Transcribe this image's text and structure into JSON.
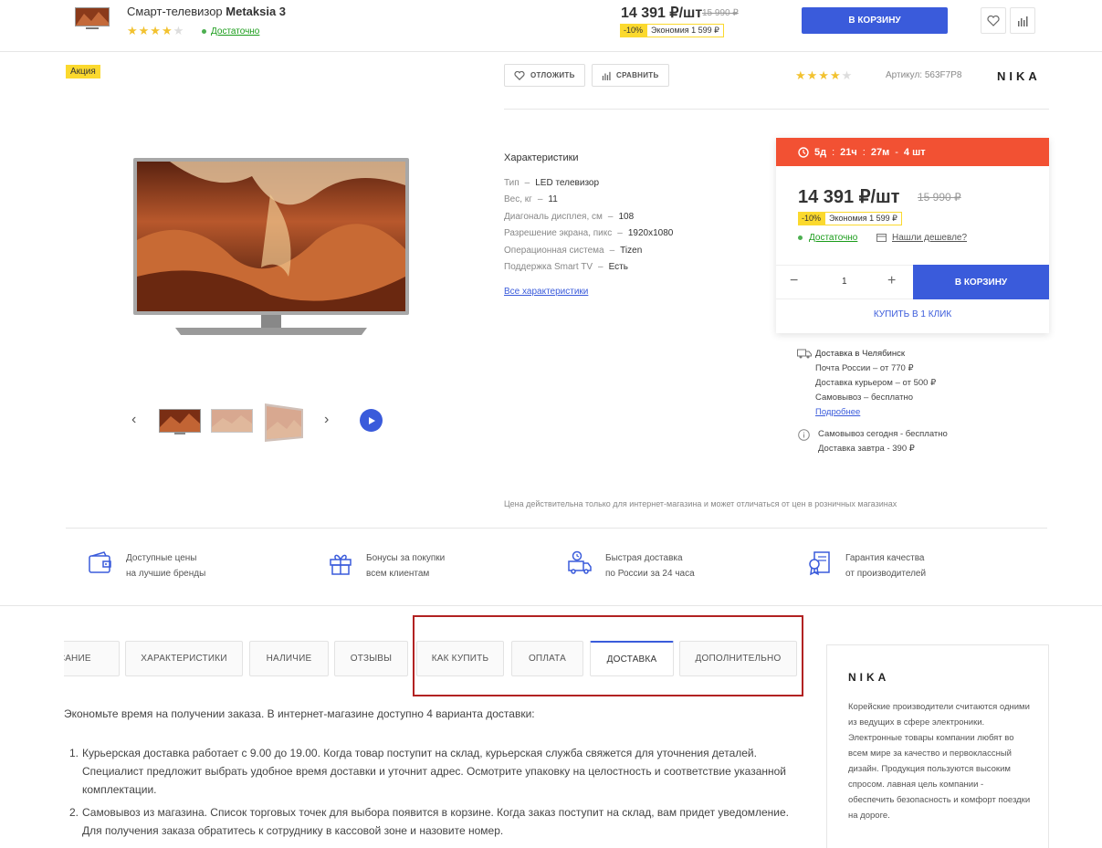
{
  "topbar": {
    "product_name_prefix": "Смарт-телевизор ",
    "product_name_model": "Metaksia 3",
    "rating_stars": 4,
    "stock": "Достаточно",
    "price": "14 391 ₽/шт",
    "old_price": "15 990 ₽",
    "discount_pct": "-10%",
    "discount_save": "Экономия 1 599 ₽",
    "cart_button": "В КОРЗИНУ"
  },
  "gallery": {
    "promo_badge": "Акция"
  },
  "actions": {
    "defer_label": "ОТЛОЖИТЬ",
    "compare_label": "СРАВНИТЬ",
    "rating_stars": 4,
    "article": "Артикул: 563F7P8",
    "brand": "NIKA"
  },
  "specs": {
    "title": "Характеристики",
    "rows": [
      {
        "k": "Тип",
        "v": "LED телевизор"
      },
      {
        "k": "Вес, кг",
        "v": "11"
      },
      {
        "k": "Диагональ дисплея, см",
        "v": "108"
      },
      {
        "k": "Разрешение экрана, пикс",
        "v": "1920x1080"
      },
      {
        "k": "Операционная система",
        "v": "Tizen"
      },
      {
        "k": "Поддержка Smart TV",
        "v": "Есть"
      }
    ],
    "all_link": "Все характеристики"
  },
  "buybox": {
    "timer_days": "5д",
    "timer_hours": "21ч",
    "timer_mins": "27м",
    "timer_sep": ":",
    "timer_dash": "-",
    "timer_qty": "4 шт",
    "price": "14 391 ₽/шт",
    "old_price": "15 990 ₽",
    "discount_pct": "-10%",
    "discount_save": "Экономия 1 599 ₽",
    "stock": "Достаточно",
    "cheaper": "Нашли дешевле?",
    "qty": "1",
    "cart_button": "В КОРЗИНУ",
    "one_click": "КУПИТЬ В 1 КЛИК"
  },
  "delivery": {
    "title": "Доставка в Челябинск",
    "post": "Почта России  –  от 770 ₽",
    "courier": "Доставка курьером  –  от 500 ₽",
    "pickup": "Самовывоз  –  бесплатно",
    "more": "Подробнее",
    "today": "Самовывоз сегодня - бесплатно",
    "tomorrow": "Доставка завтра - 390 ₽"
  },
  "disclaimer": "Цена действительна только для интернет-магазина и может отличаться от цен в розничных магазинах",
  "benefits": [
    {
      "l1": "Доступные цены",
      "l2": "на лучшие бренды"
    },
    {
      "l1": "Бонусы за покупки",
      "l2": "всем клиентам"
    },
    {
      "l1": "Быстрая доставка",
      "l2": "по России за 24 часа"
    },
    {
      "l1": "Гарантия качества",
      "l2": "от производителей"
    }
  ],
  "tabs": [
    "ОПИСАНИЕ",
    "ХАРАКТЕРИСТИКИ",
    "НАЛИЧИЕ",
    "ОТЗЫВЫ",
    "КАК КУПИТЬ",
    "ОПЛАТА",
    "ДОСТАВКА",
    "ДОПОЛНИТЕЛЬНО"
  ],
  "content": {
    "intro": "Экономьте время на получении заказа. В интернет-магазине доступно 4 варианта доставки:",
    "items": [
      {
        "n": "1.",
        "text": "Курьерская доставка работает с 9.00 до 19.00. Когда товар поступит на склад, курьерская служба свяжется для уточнения деталей. Специалист предложит выбрать удобное время доставки и уточнит адрес. Осмотрите упаковку на целостность и соответствие указанной комплектации."
      },
      {
        "n": "2.",
        "text": "Самовывоз из магазина. Список торговых точек для выбора появится в корзине. Когда заказ поступит на склад, вам придет уведомление. Для получения заказа обратитесь к сотруднику в кассовой зоне и назовите номер."
      }
    ]
  },
  "brand_card": {
    "logo": "NIKA",
    "text": "Корейские производители считаются одними из ведущих в сфере электроники. Электронные товары компании любят во всем мире за качество и первоклассный дизайн. Продукция пользуются высоким спросом. лавная цель компании - обеспечить безопасность и комфорт поездки на дороге."
  },
  "colors": {
    "accent": "#3a5bdb",
    "timer": "#f25133",
    "discount": "#fbd92e",
    "stock": "#1a9c1a",
    "highlight": "#b22222"
  }
}
